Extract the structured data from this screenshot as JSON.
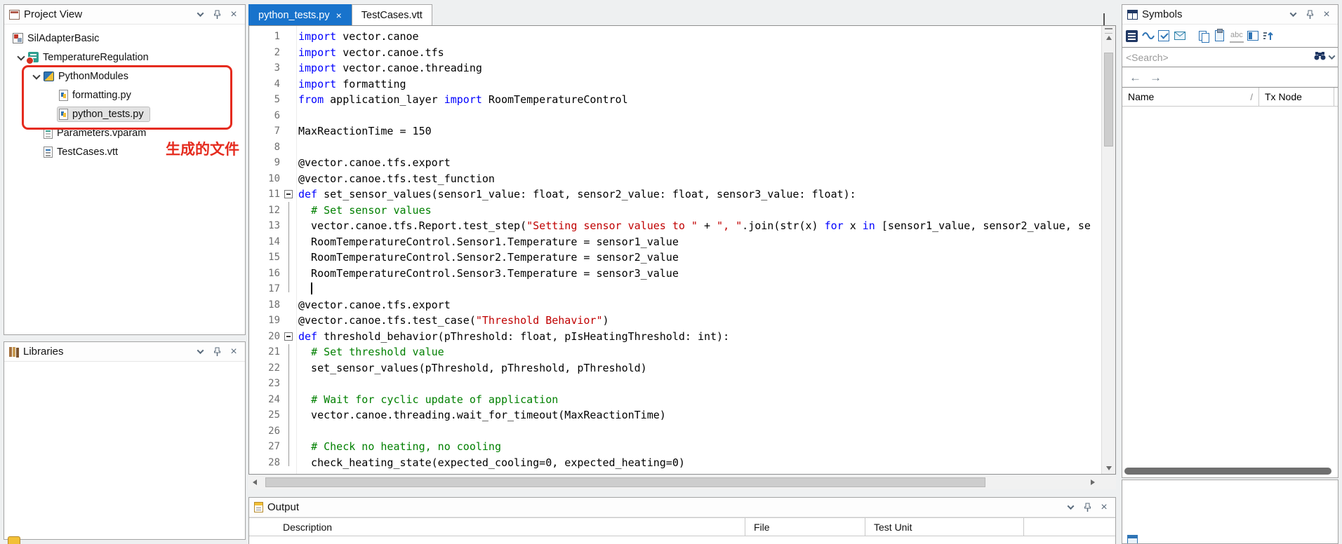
{
  "colors": {
    "active_tab_blue": "#1873cc",
    "annotation_red": "#e52b1e",
    "keyword_blue": "#0000ff",
    "string_red": "#c00000",
    "comment_green": "#008000"
  },
  "glyphs": {
    "close": "×",
    "arrow_left": "←",
    "arrow_right": "→"
  },
  "project_view": {
    "title": "Project View",
    "tree": [
      {
        "label": "SilAdapterBasic",
        "level": 0,
        "icon": "project"
      },
      {
        "label": "TemperatureRegulation",
        "level": 1,
        "icon": "testunit",
        "chevron": "expanded"
      },
      {
        "label": "PythonModules",
        "level": 2,
        "icon": "pymodule",
        "chevron": "expanded"
      },
      {
        "label": "formatting.py",
        "level": 3,
        "icon": "pyfile"
      },
      {
        "label": "python_tests.py",
        "level": 3,
        "icon": "pyfile",
        "selected": true
      },
      {
        "label": "Parameters.vparam",
        "level": 2,
        "icon": "param"
      },
      {
        "label": "TestCases.vtt",
        "level": 2,
        "icon": "vtt"
      }
    ],
    "annotation": {
      "text": "生成的文件"
    }
  },
  "libraries": {
    "title": "Libraries"
  },
  "editor": {
    "tabs": [
      {
        "label": "python_tests.py",
        "active": true,
        "closable": true
      },
      {
        "label": "TestCases.vtt",
        "active": false
      }
    ],
    "folds": [
      {
        "start": 11,
        "end": 17
      },
      {
        "start": 20,
        "end": 28
      }
    ],
    "lines": [
      {
        "n": 1,
        "segs": [
          [
            "k",
            "import"
          ],
          [
            "p",
            " vector.canoe"
          ]
        ]
      },
      {
        "n": 2,
        "segs": [
          [
            "k",
            "import"
          ],
          [
            "p",
            " vector.canoe.tfs"
          ]
        ]
      },
      {
        "n": 3,
        "segs": [
          [
            "k",
            "import"
          ],
          [
            "p",
            " vector.canoe.threading"
          ]
        ]
      },
      {
        "n": 4,
        "segs": [
          [
            "k",
            "import"
          ],
          [
            "p",
            " formatting"
          ]
        ]
      },
      {
        "n": 5,
        "segs": [
          [
            "k",
            "from"
          ],
          [
            "p",
            " application_layer "
          ],
          [
            "k",
            "import"
          ],
          [
            "p",
            " RoomTemperatureControl"
          ]
        ]
      },
      {
        "n": 6,
        "segs": []
      },
      {
        "n": 7,
        "segs": [
          [
            "p",
            "MaxReactionTime = 150"
          ]
        ]
      },
      {
        "n": 8,
        "segs": []
      },
      {
        "n": 9,
        "segs": [
          [
            "p",
            "@vector.canoe.tfs.export"
          ]
        ]
      },
      {
        "n": 10,
        "segs": [
          [
            "p",
            "@vector.canoe.tfs.test_function"
          ]
        ]
      },
      {
        "n": 11,
        "fold": true,
        "segs": [
          [
            "k",
            "def"
          ],
          [
            "p",
            " set_sensor_values(sensor1_value: float, sensor2_value: float, sensor3_value: float):"
          ]
        ]
      },
      {
        "n": 12,
        "segs": [
          [
            "p",
            "  "
          ],
          [
            "c",
            "# Set sensor values"
          ]
        ]
      },
      {
        "n": 13,
        "segs": [
          [
            "p",
            "  vector.canoe.tfs.Report.test_step("
          ],
          [
            "s",
            "\"Setting sensor values to \""
          ],
          [
            "p",
            " + "
          ],
          [
            "s",
            "\", \""
          ],
          [
            "p",
            ".join(str(x) "
          ],
          [
            "k",
            "for"
          ],
          [
            "p",
            " x "
          ],
          [
            "k",
            "in"
          ],
          [
            "p",
            " [sensor1_value, sensor2_value, se"
          ]
        ]
      },
      {
        "n": 14,
        "segs": [
          [
            "p",
            "  RoomTemperatureControl.Sensor1.Temperature = sensor1_value"
          ]
        ]
      },
      {
        "n": 15,
        "segs": [
          [
            "p",
            "  RoomTemperatureControl.Sensor2.Temperature = sensor2_value"
          ]
        ]
      },
      {
        "n": 16,
        "segs": [
          [
            "p",
            "  RoomTemperatureControl.Sensor3.Temperature = sensor3_value"
          ]
        ]
      },
      {
        "n": 17,
        "cursor": true,
        "segs": [
          [
            "p",
            "  "
          ]
        ]
      },
      {
        "n": 18,
        "segs": [
          [
            "p",
            "@vector.canoe.tfs.export"
          ]
        ]
      },
      {
        "n": 19,
        "segs": [
          [
            "p",
            "@vector.canoe.tfs.test_case("
          ],
          [
            "s",
            "\"Threshold Behavior\""
          ],
          [
            "p",
            ")"
          ]
        ]
      },
      {
        "n": 20,
        "fold": true,
        "segs": [
          [
            "k",
            "def"
          ],
          [
            "p",
            " threshold_behavior(pThreshold: float, pIsHeatingThreshold: int):"
          ]
        ]
      },
      {
        "n": 21,
        "segs": [
          [
            "p",
            "  "
          ],
          [
            "c",
            "# Set threshold value"
          ]
        ]
      },
      {
        "n": 22,
        "segs": [
          [
            "p",
            "  set_sensor_values(pThreshold, pThreshold, pThreshold)"
          ]
        ]
      },
      {
        "n": 23,
        "segs": []
      },
      {
        "n": 24,
        "segs": [
          [
            "p",
            "  "
          ],
          [
            "c",
            "# Wait for cyclic update of application"
          ]
        ]
      },
      {
        "n": 25,
        "segs": [
          [
            "p",
            "  vector.canoe.threading.wait_for_timeout(MaxReactionTime)"
          ]
        ]
      },
      {
        "n": 26,
        "segs": []
      },
      {
        "n": 27,
        "segs": [
          [
            "p",
            "  "
          ],
          [
            "c",
            "# Check no heating, no cooling"
          ]
        ]
      },
      {
        "n": 28,
        "segs": [
          [
            "p",
            "  check_heating_state(expected_cooling=0, expected_heating=0)"
          ]
        ]
      }
    ]
  },
  "output": {
    "title": "Output",
    "columns": [
      "Description",
      "File",
      "Test Unit"
    ]
  },
  "symbols": {
    "title": "Symbols",
    "search_placeholder": "<Search>",
    "toolbar": {
      "abc_label": "abc"
    },
    "columns": [
      {
        "label": "Name",
        "sort": "/"
      },
      {
        "label": "Tx Node"
      }
    ]
  }
}
